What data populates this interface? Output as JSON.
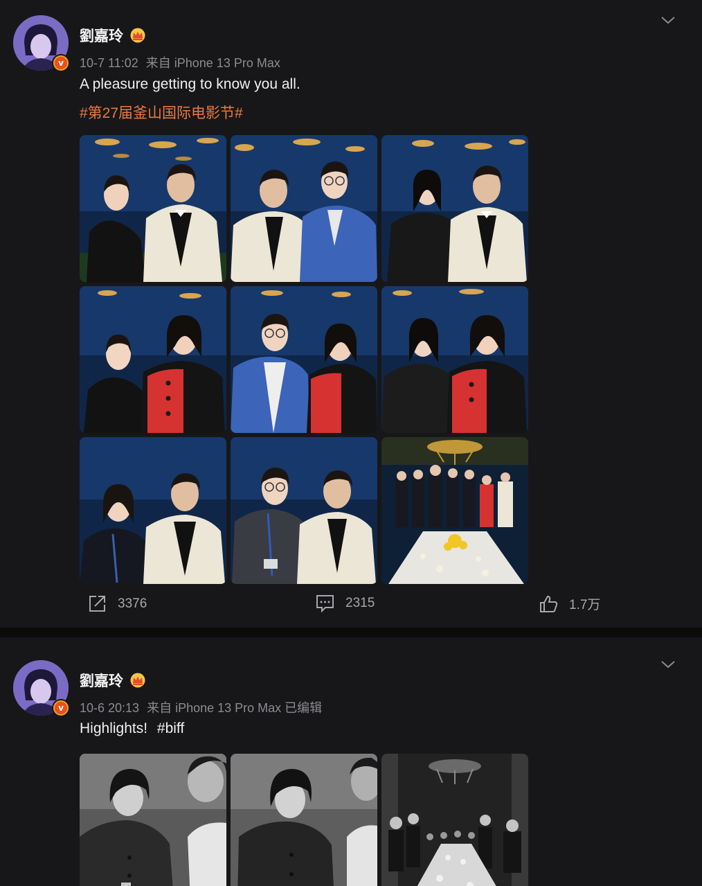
{
  "posts": [
    {
      "username": "劉嘉玲",
      "timestamp": "10-7 11:02",
      "source": "来自 iPhone 13 Pro Max",
      "text": "A pleasure getting to know you all.",
      "hashtag": "#第27届釜山国际电影节#",
      "reposts": "3376",
      "comments": "2315",
      "likes": "1.7万"
    },
    {
      "username": "劉嘉玲",
      "timestamp": "10-6 20:13",
      "source": "来自 iPhone 13 Pro Max 已编辑",
      "text": "Highlights!",
      "hashtag": "#biff"
    }
  ],
  "colors": {
    "background": "#0e0e10",
    "card": "#17171a",
    "hashtag": "#ec7a3c",
    "meta": "#8c8c90",
    "badge": "#f0a020"
  },
  "icons": [
    "chevron-down-icon",
    "crown-icon",
    "verified-badge-icon",
    "repost-icon",
    "comment-icon",
    "like-icon"
  ]
}
